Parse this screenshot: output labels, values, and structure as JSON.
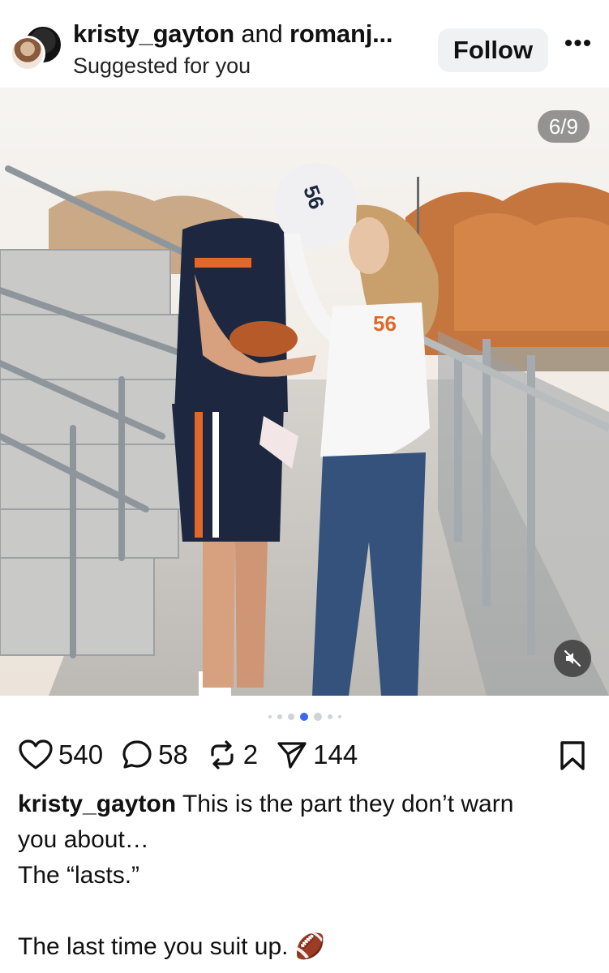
{
  "post_header": {
    "author_primary": "kristy_gayton",
    "joiner": "and",
    "author_secondary": "romanj...",
    "subtitle": "Suggested for you",
    "follow_label": "Follow",
    "more_label": "•••"
  },
  "media": {
    "counter": "6/9",
    "current_index": 6,
    "total": 9,
    "muted": true,
    "colors": {
      "sky": "#f3f1ee",
      "foliage": "#c5763f",
      "jersey_navy": "#1d2840",
      "accent_orange": "#e0682a"
    }
  },
  "carousel": {
    "dot_count": 7,
    "active_dot": 4,
    "accent": "#3d66f5"
  },
  "actions": {
    "likes": "540",
    "comments": "58",
    "reposts": "2",
    "shares": "144"
  },
  "caption": {
    "username": "kristy_gayton",
    "line1": " This is the part they don’t warn",
    "line2": "you about…",
    "line3": "The “lasts.”",
    "line4": "The last time you suit up. 🏈"
  }
}
